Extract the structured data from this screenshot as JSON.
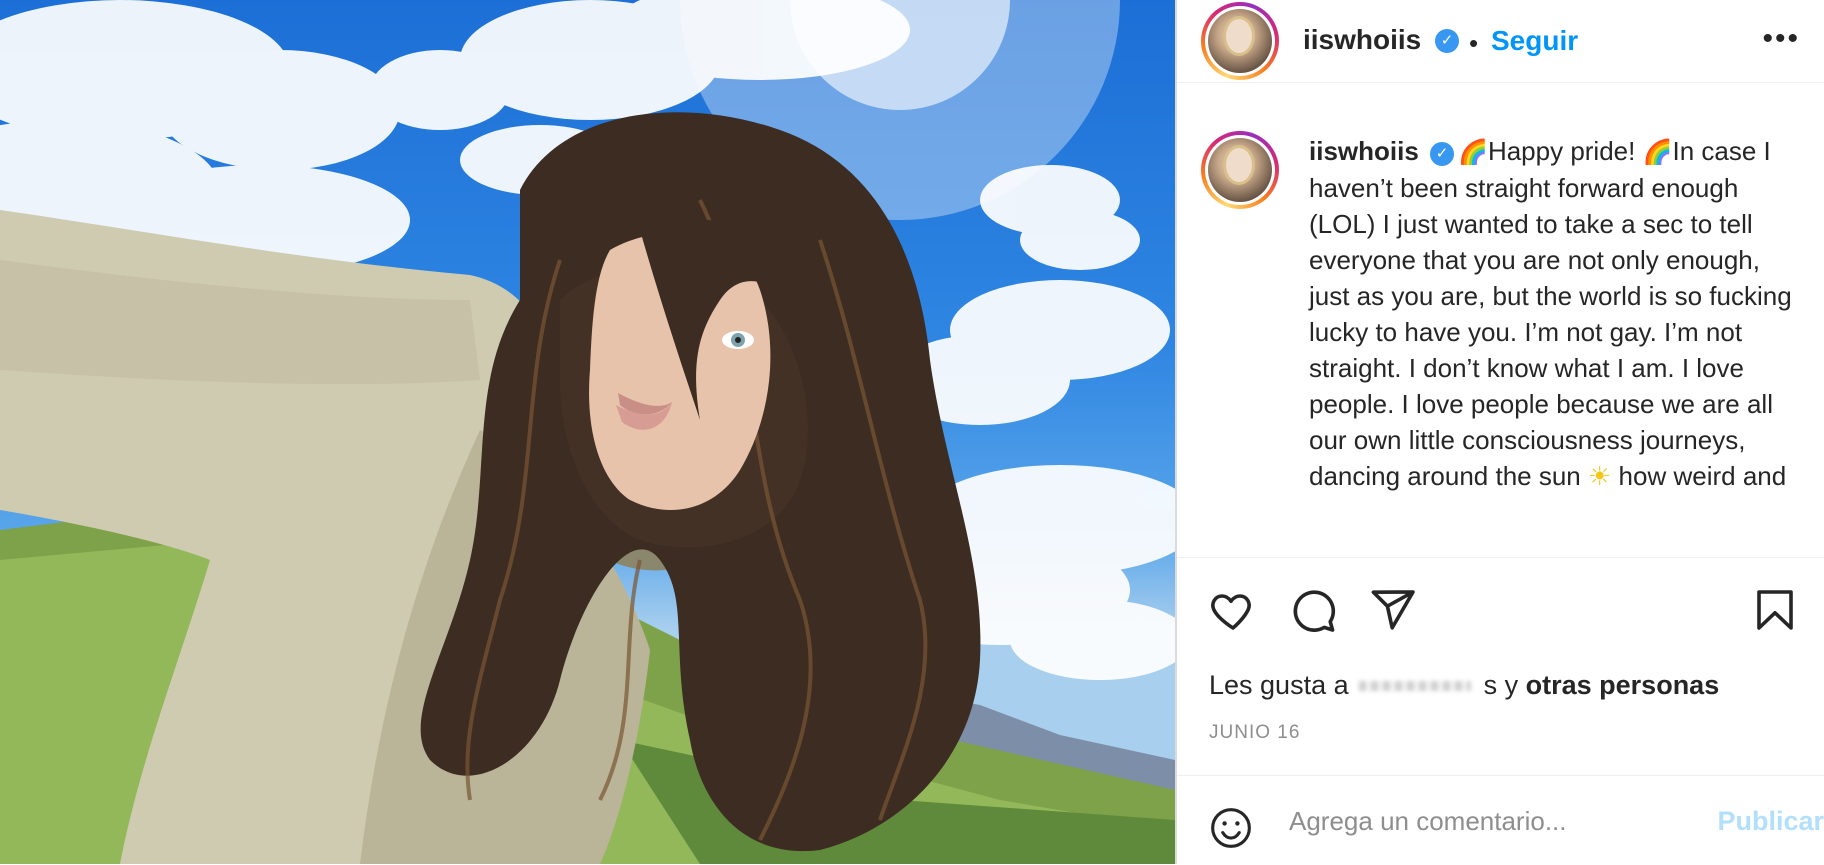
{
  "post": {
    "username": "iiswhoiis",
    "verified_mark": "✓",
    "separator": "•",
    "follow_label": "Seguir",
    "more_label": "•••",
    "caption": "Happy pride! ",
    "caption_2": "In case I haven’t been straight forward enough (LOL) I just wanted to take a sec to tell everyone that you are not only enough, just as you are, but the world is so fucking lucky to have you. I’m not gay. I’m not straight. I don’t know what I am. I love people. I love people because we are all our own little consciousness journeys, dancing around the sun",
    "caption_3": " how weird and",
    "rainbow_emoji": "🌈",
    "sun_emoji": "☀",
    "likes_prefix": "Les gusta a",
    "likes_suffix": "s y",
    "likes_bold": "otras personas",
    "date": "JUNIO 16",
    "comment_placeholder": "Agrega un comentario...",
    "publish_label": "Publicar"
  },
  "icons": {
    "like": "heart-icon",
    "comment": "comment-icon",
    "share": "paper-plane-icon",
    "save": "bookmark-icon",
    "emoji": "smiley-icon"
  },
  "colors": {
    "accent": "#0095f6",
    "verified": "#3897f0",
    "publish_disabled": "#b2dffc",
    "muted": "#8e8e8e",
    "text": "#262626"
  }
}
